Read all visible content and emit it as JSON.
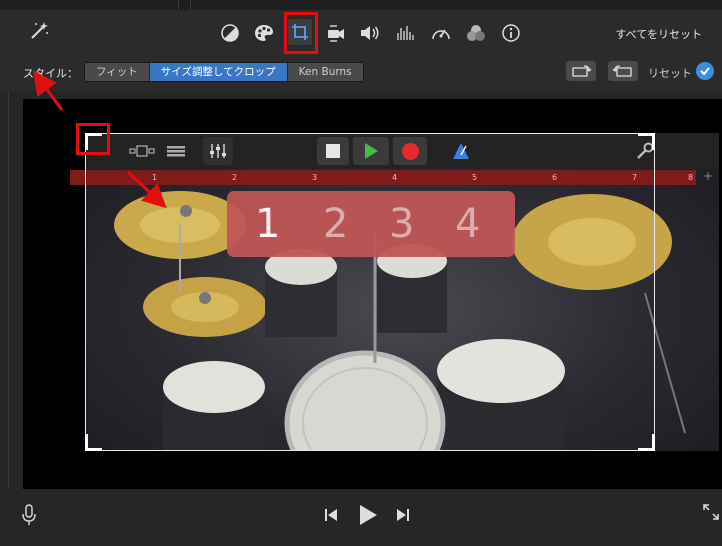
{
  "toolbar": {
    "icons": [
      "magic-wand-icon",
      "color-balance-icon",
      "palette-icon",
      "crop-icon",
      "stabilization-icon",
      "volume-icon",
      "equalizer-icon",
      "speed-icon",
      "video-overlay-icon",
      "info-icon"
    ],
    "reset_all_label": "すべてをリセット"
  },
  "style_row": {
    "label": "スタイル：",
    "options": [
      "フィット",
      "サイズ調整してクロップ",
      "Ken Burns"
    ],
    "selected": "サイズ調整してクロップ",
    "reset_label": "リセット"
  },
  "viewer": {
    "ruler_ticks": [
      "1",
      "2",
      "3",
      "4",
      "5",
      "6",
      "7",
      "8"
    ],
    "count_in": [
      "1",
      "2",
      "3",
      "4"
    ]
  },
  "colors": {
    "accent": "#3778c4",
    "annotation": "#e01010",
    "play_green": "#3fbf3f",
    "record_red": "#e62a2a"
  }
}
